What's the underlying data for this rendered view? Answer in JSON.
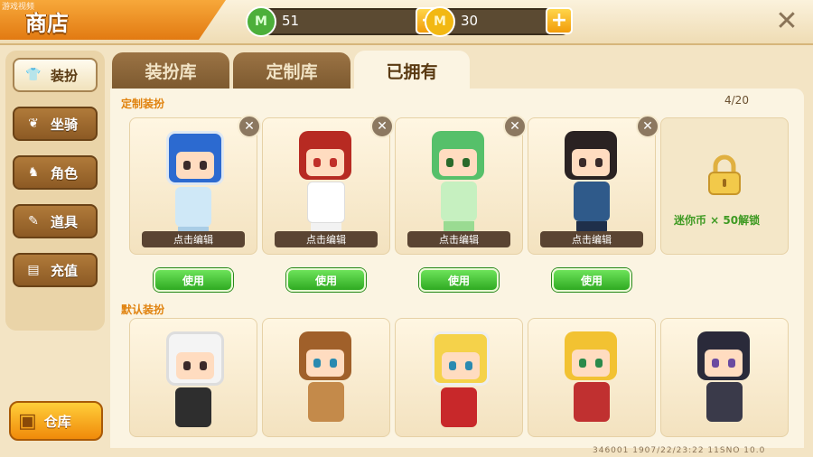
{
  "header": {
    "watermark": "游戏视频",
    "title": "商店",
    "currencies": [
      {
        "name": "green-gem",
        "value": "51",
        "color": "#4caf3a",
        "symbol": "M"
      },
      {
        "name": "gold-coin",
        "value": "30",
        "color": "#f2b812",
        "symbol": "M"
      }
    ],
    "plus_label": "+",
    "close_label": "✕"
  },
  "sidebar": {
    "items": [
      {
        "label": "装扮",
        "icon": "shirt-icon",
        "glyph": "👕",
        "active": true
      },
      {
        "label": "坐骑",
        "icon": "wings-icon",
        "glyph": "❦",
        "active": false
      },
      {
        "label": "角色",
        "icon": "cat-head-icon",
        "glyph": "♞",
        "active": false
      },
      {
        "label": "道具",
        "icon": "tool-icon",
        "glyph": "✎",
        "active": false
      },
      {
        "label": "充值",
        "icon": "coin-stack-icon",
        "glyph": "▤",
        "active": false
      }
    ],
    "warehouse_label": "仓库"
  },
  "tabs": [
    {
      "label": "装扮库",
      "active": false
    },
    {
      "label": "定制库",
      "active": false
    },
    {
      "label": "已拥有",
      "active": true
    }
  ],
  "custom_section": {
    "label": "定制装扮",
    "count": "4/20",
    "edit_label": "点击编辑",
    "use_label": "使用",
    "delete_label": "✕",
    "lock_text": "迷你币 × 50解锁"
  },
  "default_section": {
    "label": "默认装扮"
  },
  "colors": {
    "accent": "#e27a12",
    "use_green": "#2faa22",
    "tab_brown": "#8c5a24"
  },
  "footer_text": "346001    1907/22/23:22    11SNO 10.0"
}
